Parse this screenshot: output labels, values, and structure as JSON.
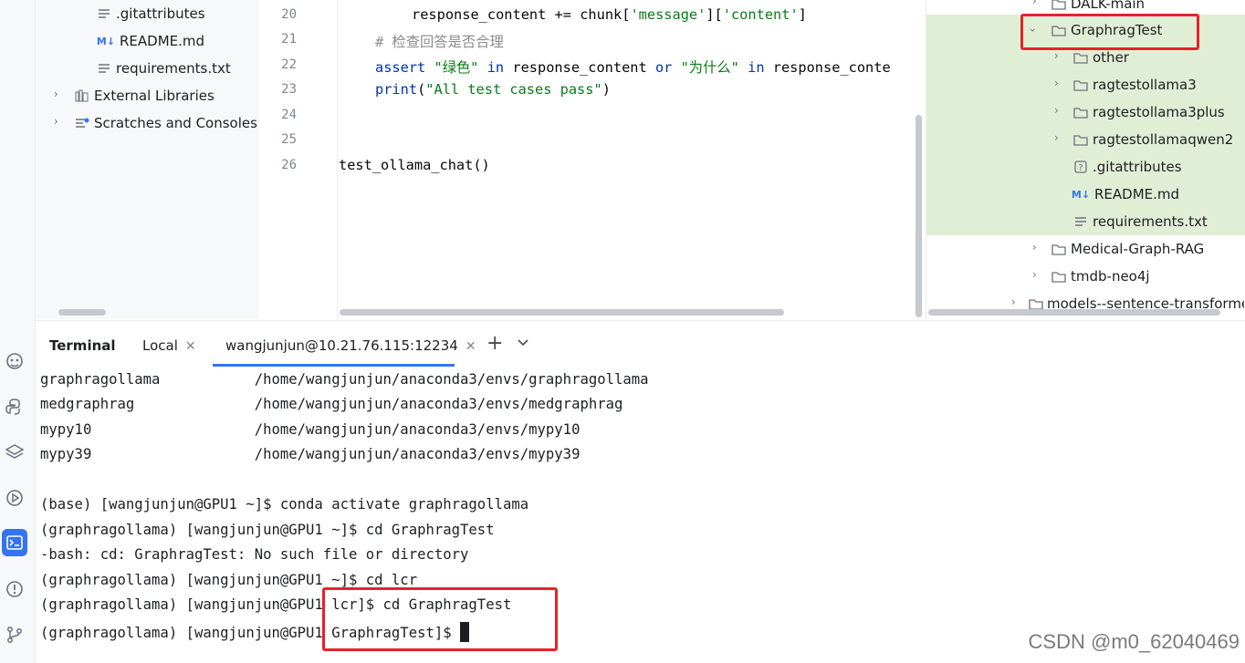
{
  "project_left": {
    "items": [
      {
        "label": ".gitattributes",
        "icon": "lines-icon"
      },
      {
        "label": "README.md",
        "icon": "markdown-icon"
      },
      {
        "label": "requirements.txt",
        "icon": "lines-icon"
      },
      {
        "label": "External Libraries",
        "icon": "library-icon"
      },
      {
        "label": "Scratches and Consoles",
        "icon": "scratches-icon"
      }
    ]
  },
  "editor": {
    "line_numbers": [
      "20",
      "21",
      "22",
      "23",
      "24",
      "25",
      "26"
    ],
    "lines": {
      "l20_a": "response_content += chunk[",
      "l20_b": "'message'",
      "l20_c": "][",
      "l20_d": "'content'",
      "l20_e": "]",
      "l21": "# 检查回答是否合理",
      "l22_a": "assert",
      "l22_b": "\"绿色\"",
      "l22_c": "in",
      "l22_d": "response_content",
      "l22_e": "or",
      "l22_f": "\"为什么\"",
      "l22_g": "in",
      "l22_h": "response_conte",
      "l23_a": "print",
      "l23_b": "(",
      "l23_c": "\"All test cases pass\"",
      "l23_d": ")",
      "l26": "test_ollama_chat()"
    }
  },
  "project_right": {
    "items": [
      {
        "label": "DALK-main"
      },
      {
        "label": "GraphragTest"
      },
      {
        "label": "other"
      },
      {
        "label": "ragtestollama3"
      },
      {
        "label": "ragtestollama3plus"
      },
      {
        "label": "ragtestollamaqwen2"
      },
      {
        "label": ".gitattributes"
      },
      {
        "label": "README.md"
      },
      {
        "label": "requirements.txt"
      },
      {
        "label": "Medical-Graph-RAG"
      },
      {
        "label": "tmdb-neo4j"
      },
      {
        "label": "models--sentence-transforme"
      }
    ],
    "highlight_color": "#e1eed6",
    "annotation_color": "#e8212b"
  },
  "terminal": {
    "title": "Terminal",
    "tabs": [
      {
        "label": "Local"
      },
      {
        "label": "wangjunjun@10.21.76.115:12234"
      }
    ],
    "lines": [
      "graphragollama           /home/wangjunjun/anaconda3/envs/graphragollama",
      "medgraphrag              /home/wangjunjun/anaconda3/envs/medgraphrag",
      "mypy10                   /home/wangjunjun/anaconda3/envs/mypy10",
      "mypy39                   /home/wangjunjun/anaconda3/envs/mypy39",
      "",
      "(base) [wangjunjun@GPU1 ~]$ conda activate graphragollama",
      "(graphragollama) [wangjunjun@GPU1 ~]$ cd GraphragTest",
      "-bash: cd: GraphragTest: No such file or directory",
      "(graphragollama) [wangjunjun@GPU1 ~]$ cd lcr",
      "(graphragollama) [wangjunjun@GPU1 lcr]$ cd GraphragTest",
      "(graphragollama) [wangjunjun@GPU1 GraphragTest]$ "
    ],
    "accent_color": "#3574f0"
  },
  "watermark": "CSDN @m0_62040469"
}
